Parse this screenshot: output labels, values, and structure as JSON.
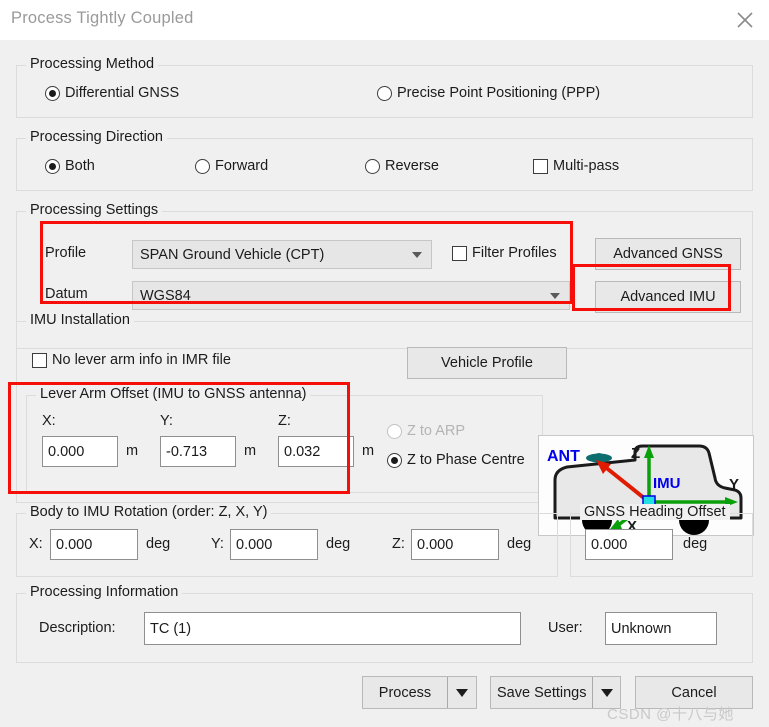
{
  "window": {
    "title": "Process Tightly Coupled",
    "close_icon": "close-icon"
  },
  "processing_method": {
    "legend": "Processing Method",
    "options": [
      {
        "label": "Differential GNSS",
        "selected": true
      },
      {
        "label": "Precise Point Positioning (PPP)",
        "selected": false
      }
    ]
  },
  "processing_direction": {
    "legend": "Processing Direction",
    "options": [
      {
        "label": "Both",
        "selected": true
      },
      {
        "label": "Forward",
        "selected": false
      },
      {
        "label": "Reverse",
        "selected": false
      }
    ],
    "multi_pass": {
      "label": "Multi-pass",
      "checked": false
    }
  },
  "processing_settings": {
    "legend": "Processing Settings",
    "profile_label": "Profile",
    "profile_value": "SPAN Ground Vehicle (CPT)",
    "filter_profiles": {
      "label": "Filter Profiles",
      "checked": true
    },
    "datum_label": "Datum",
    "datum_value": "WGS84",
    "advanced_gnss_button": "Advanced GNSS",
    "advanced_imu_button": "Advanced IMU"
  },
  "imu_installation": {
    "legend": "IMU Installation",
    "no_lever_arm": {
      "label": "No lever arm info in IMR file",
      "checked": false
    },
    "vehicle_profile_button": "Vehicle Profile"
  },
  "lever_arm_offset": {
    "legend": "Lever Arm Offset (IMU to GNSS antenna)",
    "x_label": "X:",
    "x_value": "0.000",
    "x_unit": "m",
    "y_label": "Y:",
    "y_value": "-0.713",
    "y_unit": "m",
    "z_label": "Z:",
    "z_value": "0.032",
    "z_unit": "m",
    "z_to_arp": {
      "label": "Z to ARP",
      "selected": false,
      "disabled": true
    },
    "z_to_phase_centre": {
      "label": "Z to Phase Centre",
      "selected": true,
      "disabled": false
    }
  },
  "vehicle_diagram": {
    "ant_label": "ANT",
    "imu_label": "IMU",
    "axis_z": "Z",
    "axis_y": "Y",
    "axis_x": "X",
    "ant_color": "#0000ee",
    "imu_color": "#0000ee",
    "lever_arm_color": "#e01b00",
    "axis_color": "#0aa00a"
  },
  "body_to_imu_rotation": {
    "legend": "Body to IMU Rotation (order: Z, X, Y)",
    "x_label": "X:",
    "x_value": "0.000",
    "x_unit": "deg",
    "y_label": "Y:",
    "y_value": "0.000",
    "y_unit": "deg",
    "z_label": "Z:",
    "z_value": "0.000",
    "z_unit": "deg"
  },
  "gnss_heading_offset": {
    "legend": "GNSS Heading Offset",
    "value": "0.000",
    "unit": "deg"
  },
  "processing_information": {
    "legend": "Processing Information",
    "description_label": "Description:",
    "description_value": "TC (1)",
    "user_label": "User:",
    "user_value": "Unknown"
  },
  "footer": {
    "process_button": "Process",
    "save_settings_button": "Save Settings",
    "cancel_button": "Cancel"
  },
  "watermark": "CSDN @十八与她",
  "colors": {
    "annotation_red": "#f60f09",
    "dialog_background": "#f0f0f0",
    "titlebar_background": "#ffffff",
    "group_border": "#dcdcdc"
  }
}
